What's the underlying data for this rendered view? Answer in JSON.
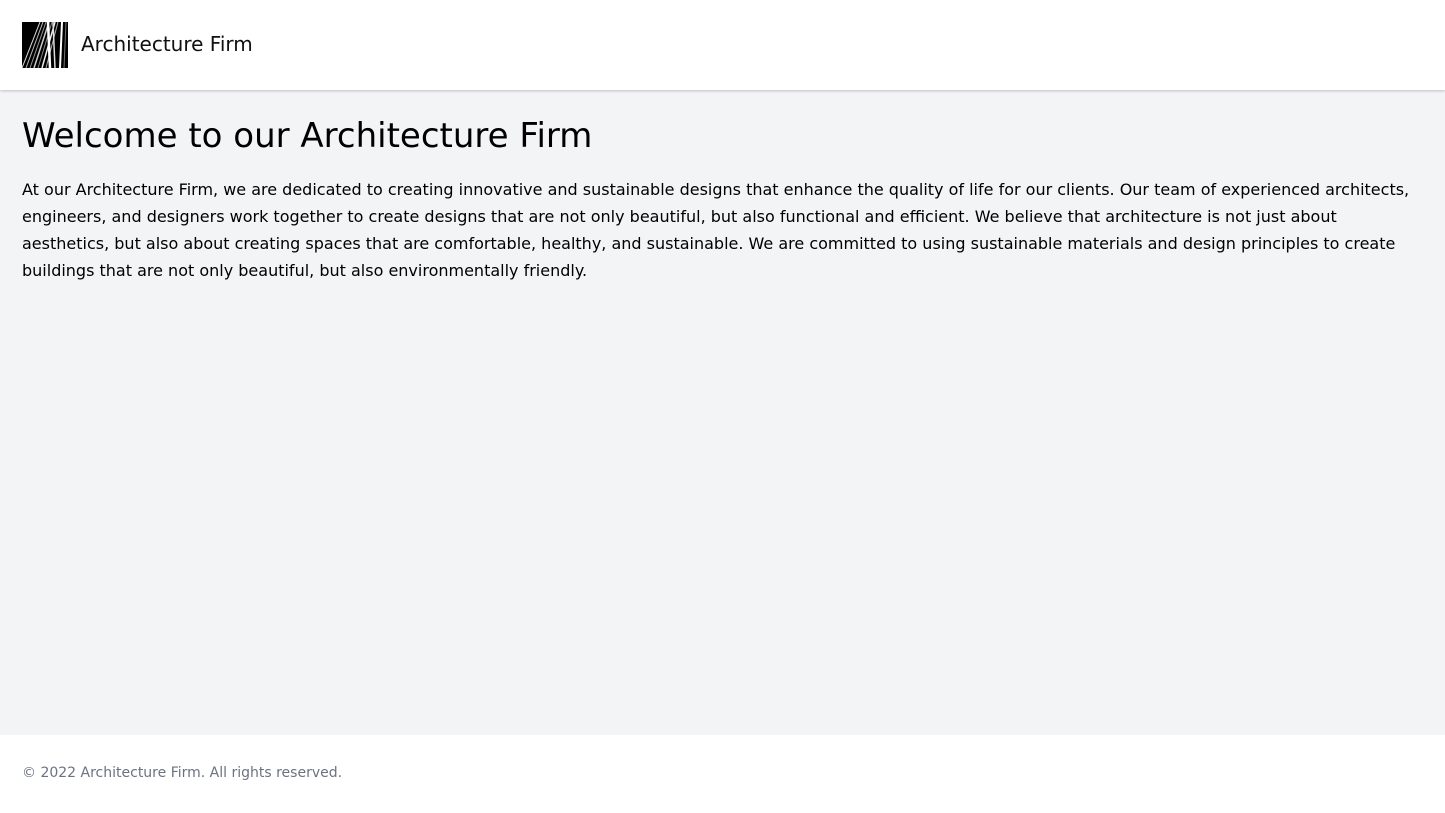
{
  "header": {
    "logo_icon": "building-facade-icon",
    "brand_name": "Architecture Firm"
  },
  "main": {
    "title": "Welcome to our Architecture Firm",
    "intro": "At our Architecture Firm, we are dedicated to creating innovative and sustainable designs that enhance the quality of life for our clients. Our team of experienced architects, engineers, and designers work together to create designs that are not only beautiful, but also functional and efficient. We believe that architecture is not just about aesthetics, but also about creating spaces that are comfortable, healthy, and sustainable. We are committed to using sustainable materials and design principles to create buildings that are not only beautiful, but also environmentally friendly."
  },
  "footer": {
    "copyright": "© 2022 Architecture Firm. All rights reserved."
  },
  "colors": {
    "page_background": "#f3f4f6",
    "surface": "#ffffff",
    "footer_text": "#6b7280"
  }
}
